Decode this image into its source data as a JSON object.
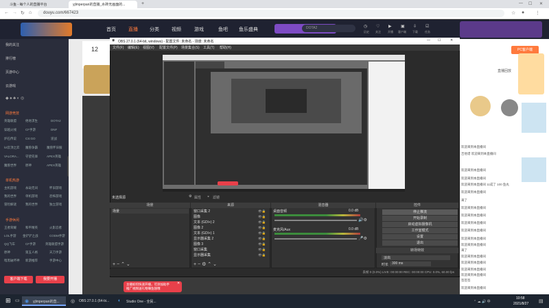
{
  "browser": {
    "tabs": [
      {
        "label": "斗鱼 - 每个人的直播平台"
      },
      {
        "label": "yjlmperpan的直播_水砖无画面的..."
      }
    ],
    "url": "douyu.com/667423"
  },
  "site": {
    "nav": [
      "首页",
      "直播",
      "分类",
      "视频",
      "游戏",
      "鱼吧",
      "鱼乐盛典"
    ],
    "header_icons": [
      "历史",
      "关注",
      "开播",
      "客户端",
      "下载",
      "任务"
    ],
    "dota_tag": "DOTA2",
    "follow_count": "12"
  },
  "sidebar": {
    "items": [
      "我的关注",
      "排行榜",
      "页游中心",
      "云游戏"
    ],
    "section_game": "网游竞技",
    "games_1": [
      "英雄联盟",
      "绝地求生",
      "DOTA2",
      "穿越火线",
      "CF手游",
      "DNF",
      "炉石传说",
      "CS:GO",
      "逆战",
      "lol云顶之弈",
      "魔兽争霸",
      "魔兽怀旧服",
      "VALORA...",
      "守望先锋",
      "APEX英雄",
      "魔兽世界",
      "原神",
      "APEX英雄"
    ],
    "section_single": "单机热游",
    "games_2": [
      "主机游戏",
      "永劫无间",
      "怀旧游戏",
      "我的世界",
      "单机游戏",
      "恐怖游戏",
      "冒险解谜",
      "我的世界",
      "独立游戏"
    ],
    "section_mobile": "手游休闲",
    "games_3": [
      "王者荣耀",
      "和平精英",
      "火影忍者",
      "LOL手游",
      "金铲铲之战",
      "CODM手游",
      "QQ飞车",
      "CF手游",
      "英雄联盟手游",
      "原神",
      "第五人格",
      "天刀手游",
      "暗黑破坏神",
      "新游推荐",
      "手游中心"
    ],
    "btn_download": "客户端下载",
    "btn_broadcast": "我要开播"
  },
  "obs": {
    "title": "OBS 27.0.1 (64-bit, windows) - 配置文件: 未命名 - 场景: 未命名",
    "menu": [
      "文件(F)",
      "编辑(E)",
      "视图(V)",
      "配置文件(P)",
      "场景集合(S)",
      "工具(T)",
      "帮助(H)"
    ],
    "no_source": "未选择源",
    "props": "属性",
    "filters": "滤镜",
    "docks": [
      "场景",
      "来源",
      "混音器",
      "转场特效",
      "控件"
    ],
    "scene": "场景",
    "sources": [
      "窗口采集 2",
      "图像",
      "文本 (GDI+) 2",
      "图像 2",
      "文本 (GDI+) 1",
      "显示器采集 2",
      "图像 3",
      "窗口采集",
      "显示器采集"
    ],
    "mixer": [
      "桌面音频",
      "麦克风/Aux"
    ],
    "mixer_db": [
      "0.0 dB",
      "0.0 dB"
    ],
    "controls": [
      "停止推流",
      "开始录制",
      "启动虚拟摄像机",
      "工作室模式",
      "设置",
      "退出"
    ],
    "transition_label": "转场特效",
    "transition": "淡出",
    "duration_label": "时长",
    "duration": "300 ms",
    "status": "丢帧 0 (0.0%)   LIVE: 00:00:00   REC: 00:00:00   CPU: 0.0%, 60.00 fps"
  },
  "notice": "主播如何快速开播，可添加助手\n推广视频送礼物赚鱼翅哦",
  "chat": {
    "lines": [
      "欢迎来到本直播间",
      "吉他谱 欢迎来到本直播间",
      "欢迎来到本直播间",
      "欢迎来到本直播间",
      "欢迎来到本直播间 11成了 100 鱼丸",
      "欢迎来到本直播间",
      "来了",
      "欢迎来到本直播间",
      "欢迎来到本直播间",
      "欢迎来到本直播间",
      "欢迎来到本直播间",
      "欢迎来到本直播间",
      "欢迎来到本直播间",
      "来了",
      "欢迎来到本直播间",
      "欢迎来到本直播间",
      "欢迎来到本直播间",
      "欢迎来到本直播间",
      "签签签",
      "欢迎来到本直播间"
    ],
    "pc_btn": "PC客户端",
    "report": "直播回放"
  },
  "taskbar": {
    "items": [
      "yjlmperpan的直...",
      "OBS 27.0.1 (64-bi...",
      "Studio One - 全民..."
    ],
    "time": "10:58",
    "date": "2021/8/27"
  },
  "colors": {
    "accent": "#ff7a3d",
    "obs_bg": "#2b2b2b",
    "live_red": "#e8404a"
  }
}
